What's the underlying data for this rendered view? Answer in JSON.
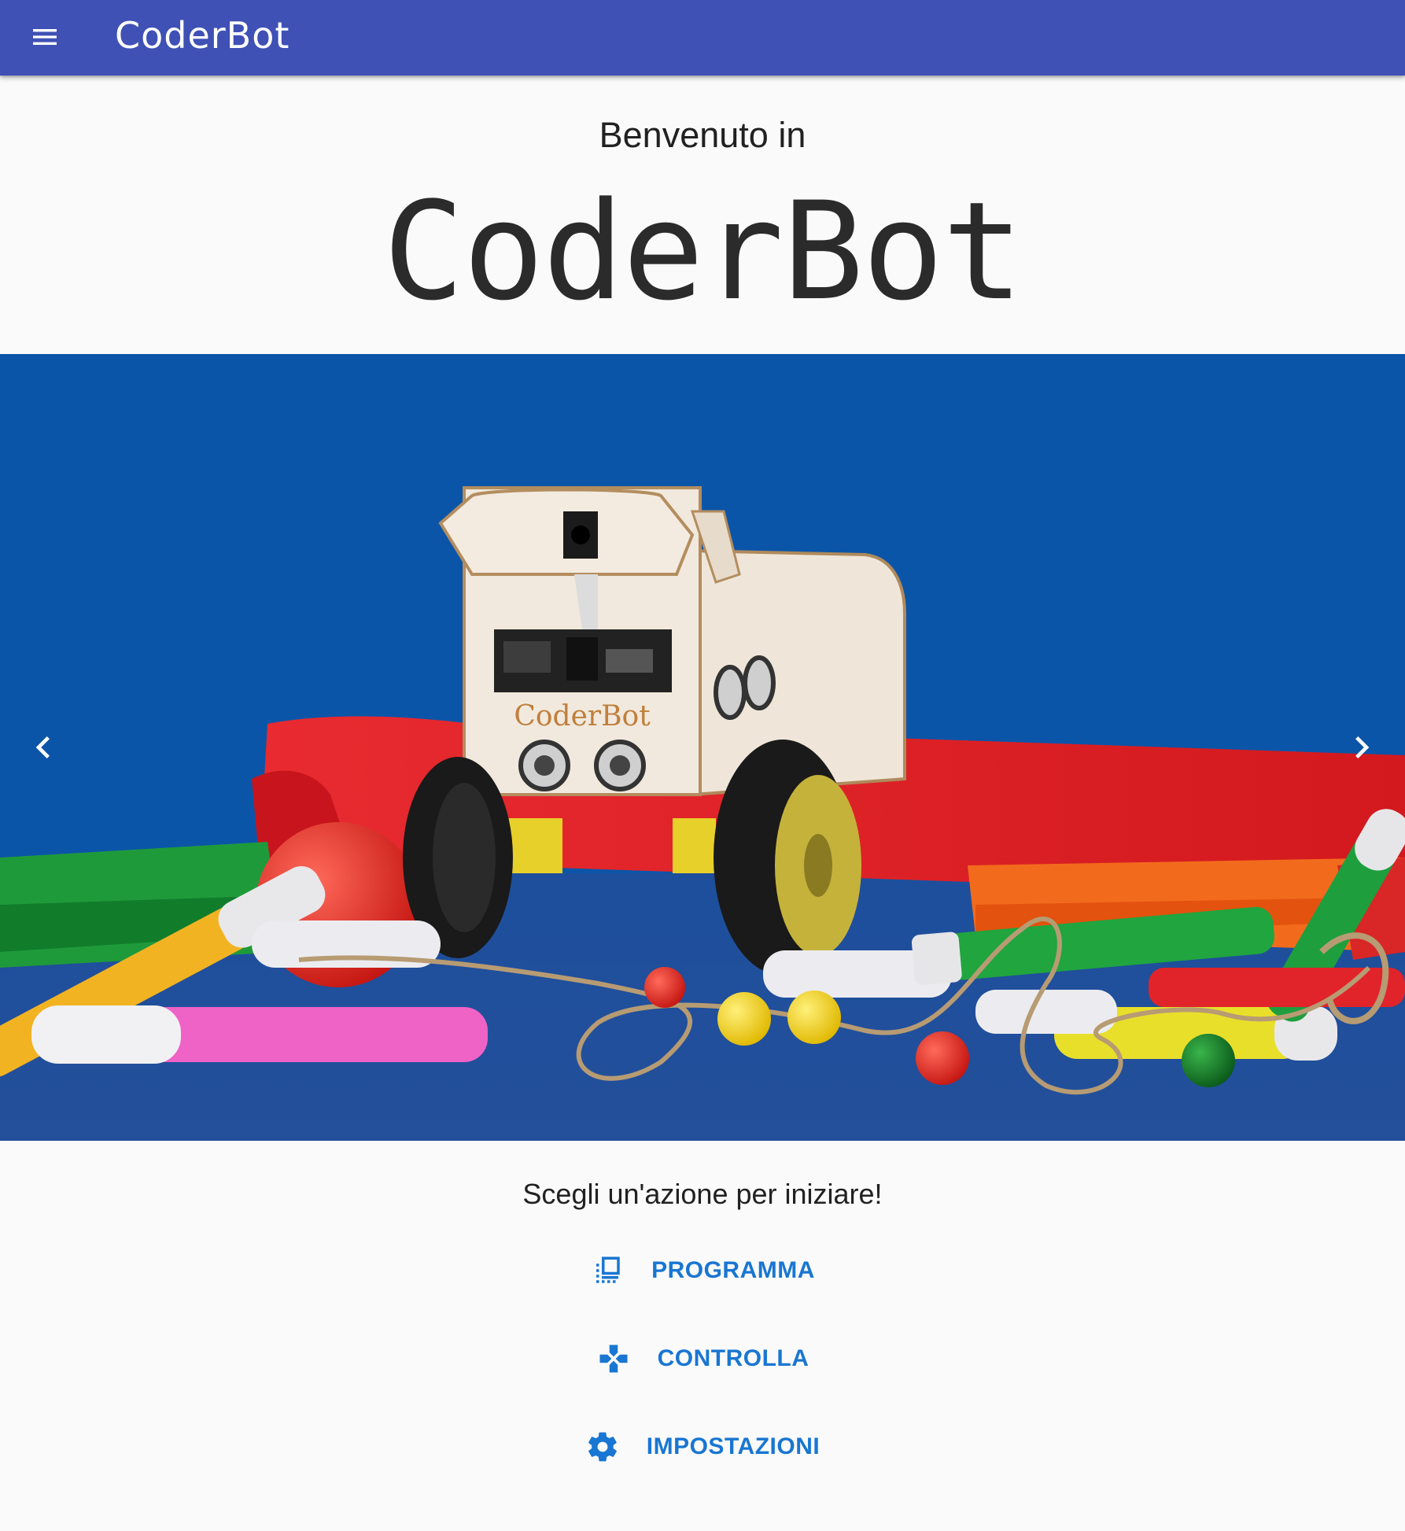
{
  "colors": {
    "toolbar": "#3f51b5",
    "accent": "#1976d2",
    "carousel_bg": "#0b55a8"
  },
  "toolbar": {
    "menu_icon": "hamburger-menu-icon",
    "title": "CoderBot"
  },
  "welcome": {
    "line1": "Benvenuto in",
    "logo": "CoderBot"
  },
  "carousel": {
    "image_alt": "CoderBot robot with markers",
    "robot_label": "CoderBot",
    "prev_icon": "chevron-left-icon",
    "next_icon": "chevron-right-icon"
  },
  "prompt": "Scegli un'azione per iniziare!",
  "actions": [
    {
      "icon": "program-icon",
      "label": "PROGRAMMA"
    },
    {
      "icon": "gamepad-icon",
      "label": "CONTROLLA"
    },
    {
      "icon": "gear-icon",
      "label": "IMPOSTAZIONI"
    }
  ]
}
